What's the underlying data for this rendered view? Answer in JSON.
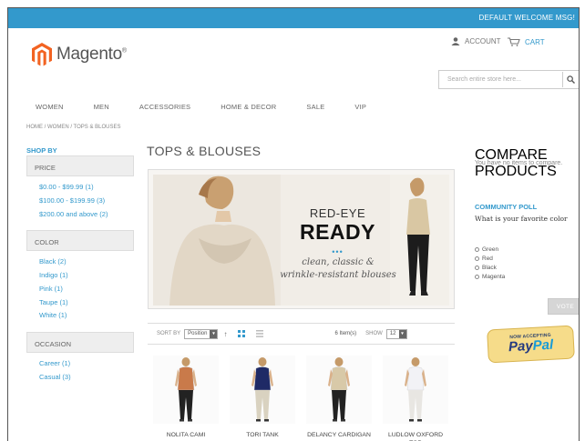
{
  "header": {
    "welcome": "DEFAULT WELCOME MSG!",
    "logo_text": "Magento",
    "account": "ACCOUNT",
    "cart": "CART",
    "search_placeholder": "Search entire store here..."
  },
  "nav": [
    "WOMEN",
    "MEN",
    "ACCESSORIES",
    "HOME & DECOR",
    "SALE",
    "VIP"
  ],
  "breadcrumb": "HOME / WOMEN / TOPS & BLOUSES",
  "sidebar": {
    "shop_by": "SHOP BY",
    "filters": [
      {
        "title": "PRICE",
        "items": [
          "$0.00 - $99.99 (1)",
          "$100.00 - $199.99 (3)",
          "$200.00 and above (2)"
        ]
      },
      {
        "title": "COLOR",
        "items": [
          "Black (2)",
          "Indigo (1)",
          "Pink (1)",
          "Taupe (1)",
          "White (1)"
        ]
      },
      {
        "title": "OCCASION",
        "items": [
          "Career (1)",
          "Casual (3)"
        ]
      }
    ]
  },
  "main": {
    "title": "TOPS & BLOUSES",
    "banner": {
      "line1": "RED-EYE",
      "line2": "READY",
      "dots": "•••",
      "tagline1": "clean, classic &",
      "tagline2": "wrinkle-resistant blouses"
    },
    "toolbar": {
      "sort_label": "SORT BY",
      "sort_value": "Position",
      "items_count": "6 Item(s)",
      "show_label": "SHOW",
      "show_value": "12"
    },
    "products": [
      {
        "name": "NOLITA CAMI",
        "shirt": "#c97a4a",
        "pants": "#222222"
      },
      {
        "name": "TORI TANK",
        "shirt": "#1f2a66",
        "pants": "#d9d2c0"
      },
      {
        "name": "DELANCY CARDIGAN",
        "shirt": "#d8c9a8",
        "pants": "#222222"
      },
      {
        "name": "LUDLOW OXFORD TOP",
        "shirt": "#f2f2f6",
        "pants": "#e8e6e2"
      }
    ]
  },
  "right": {
    "compare_title": "COMPARE PRODUCTS",
    "compare_text": "You have no items to compare.",
    "poll_title": "COMMUNITY POLL",
    "poll_question": "What is your favorite color",
    "poll_options": [
      "Green",
      "Red",
      "Black",
      "Magenta"
    ],
    "vote_label": "VOTE",
    "paypal_small": "NOW ACCEPTING",
    "paypal_pay": "Pay",
    "paypal_pal": "Pal"
  },
  "colors": {
    "accent": "#3399cc",
    "paypal_badge": "#f6dc8a"
  }
}
